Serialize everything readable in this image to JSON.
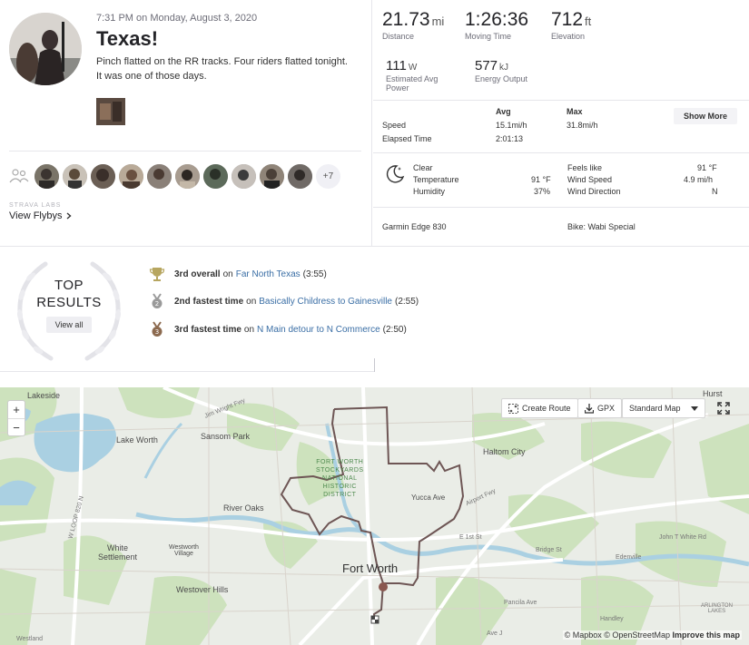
{
  "activity": {
    "date": "7:31 PM on Monday, August 3, 2020",
    "title": "Texas!",
    "description_line1": "Pinch flatted on the RR tracks. Four riders flatted tonight.",
    "description_line2": "It was one of those days.",
    "riders_more": "+7",
    "labs_label": "STRAVA LABS",
    "flybys_label": "View Flybys"
  },
  "stats": {
    "distance": {
      "value": "21.73",
      "unit": "mi",
      "label": "Distance"
    },
    "moving_time": {
      "value": "1:26:36",
      "label": "Moving Time"
    },
    "elevation": {
      "value": "712",
      "unit": "ft",
      "label": "Elevation"
    },
    "power": {
      "value": "111",
      "unit": "W",
      "label_line1": "Estimated Avg",
      "label_line2": "Power"
    },
    "energy": {
      "value": "577",
      "unit": "kJ",
      "label": "Energy Output"
    }
  },
  "table": {
    "avg_header": "Avg",
    "max_header": "Max",
    "show_more": "Show More",
    "speed_label": "Speed",
    "speed_avg": "15.1mi/h",
    "speed_max": "31.8mi/h",
    "elapsed_label": "Elapsed Time",
    "elapsed_avg": "2:01:13"
  },
  "weather": {
    "condition": "Clear",
    "temp_label": "Temperature",
    "temp_value": "91 °F",
    "humidity_label": "Humidity",
    "humidity_value": "37%",
    "feels_label": "Feels like",
    "feels_value": "91 °F",
    "wind_speed_label": "Wind Speed",
    "wind_speed_value": "4.9 mi/h",
    "wind_dir_label": "Wind Direction",
    "wind_dir_value": "N"
  },
  "gear": {
    "device": "Garmin Edge 830",
    "bike": "Bike: Wabi Special"
  },
  "results": {
    "heading_line1": "TOP",
    "heading_line2": "RESULTS",
    "view_all": "View all",
    "items": [
      {
        "rank": "3rd overall",
        "on": "on",
        "segment": "Far North Texas",
        "time": "(3:55)",
        "medal_color": "#b7a660"
      },
      {
        "rank": "2nd fastest time",
        "on": "on",
        "segment": "Basically Childress to Gainesville",
        "time": "(2:55)",
        "medal_color": "#9a9a9a"
      },
      {
        "rank": "3rd fastest time",
        "on": "on",
        "segment": "N Main detour to N Commerce",
        "time": "(2:50)",
        "medal_color": "#8c6a4f"
      }
    ]
  },
  "map": {
    "zoom_in": "+",
    "zoom_out": "−",
    "create_route": "Create Route",
    "gpx": "GPX",
    "map_style": "Standard Map",
    "attribution_mapbox": "© Mapbox",
    "attribution_osm": "© OpenStreetMap",
    "attribution_improve": "Improve this map",
    "labels": {
      "lakeside": "Lakeside",
      "hurst": "Hurst",
      "lake_worth": "Lake Worth",
      "sansom_park": "Sansom Park",
      "haltom_city": "Haltom City",
      "river_oaks": "River Oaks",
      "stockyards_1": "FORT WORTH",
      "stockyards_2": "STOCKYARDS",
      "stockyards_3": "NATIONAL",
      "stockyards_4": "HISTORIC",
      "stockyards_5": "DISTRICT",
      "yucca_ave": "Yucca Ave",
      "white_settlement_1": "White",
      "white_settlement_2": "Settlement",
      "westworth_1": "Westworth",
      "westworth_2": "Village",
      "fort_worth": "Fort Worth",
      "westover_hills": "Westover Hills",
      "e_1st_st": "E 1st St",
      "bridge_st": "Bridge St",
      "edenville": "Edenville",
      "john_t_white": "John T White Rd",
      "pancila_ave": "Pancila Ave",
      "handley": "Handley",
      "arlington_1": "ARLINGTON",
      "arlington_2": "LAKES",
      "airport_fwy": "Airport Fwy",
      "jim_wright": "Jim Wright Fwy",
      "w_loop": "W LOOP 820 N",
      "westland": "Westland",
      "ave_j": "Ave J"
    }
  },
  "colors": {
    "accent": "#fc4c02",
    "route": "#6e5655",
    "water": "#a9cfe0",
    "park": "#c8dfb7",
    "link": "#3a6ea5"
  }
}
